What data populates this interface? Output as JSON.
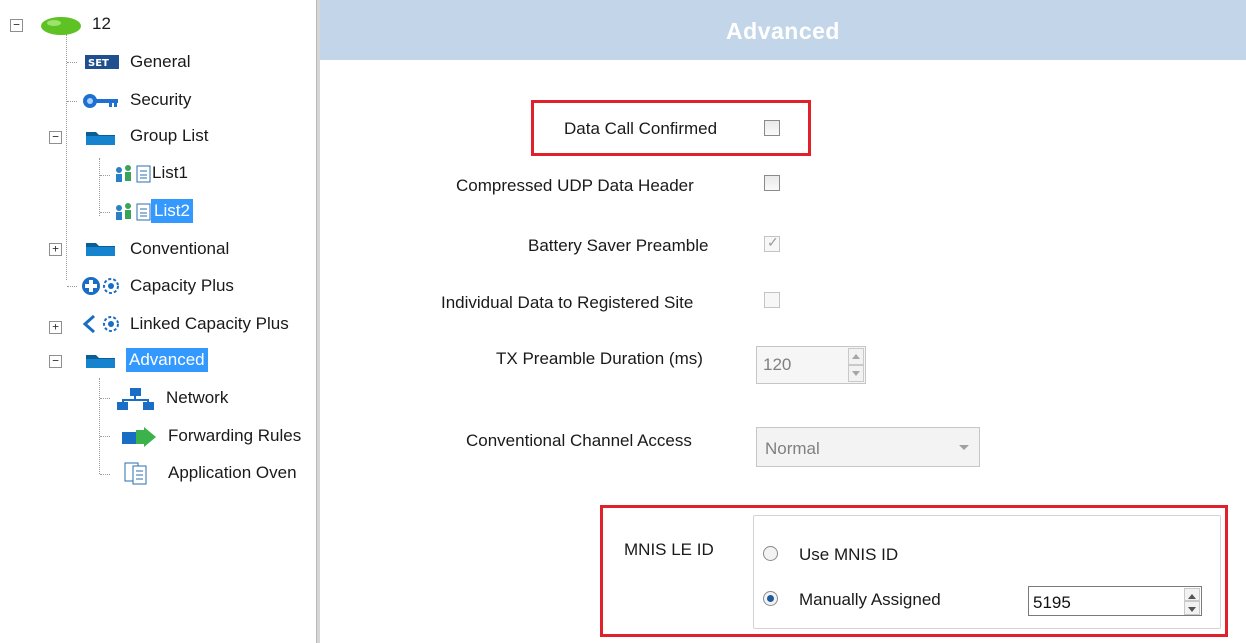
{
  "tree": {
    "root_label": "12",
    "items": {
      "general": "General",
      "security": "Security",
      "group_list": "Group List",
      "list1": "List1",
      "list2": "List2",
      "conventional": "Conventional",
      "capacity_plus": "Capacity Plus",
      "linked_capacity_plus": "Linked Capacity Plus",
      "advanced": "Advanced",
      "network": "Network",
      "forwarding_rules": "Forwarding Rules",
      "application_overview": "Application Oven"
    },
    "selected": [
      "List2",
      "Advanced"
    ],
    "expander_collapsed": "+",
    "expander_expanded": "−",
    "general_icon_text": "SET"
  },
  "header": {
    "title": "Advanced"
  },
  "form": {
    "data_call_confirmed": {
      "label": "Data Call Confirmed",
      "checked": false,
      "enabled": true
    },
    "compressed_udp": {
      "label": "Compressed UDP Data Header",
      "checked": false,
      "enabled": true
    },
    "battery_saver": {
      "label": "Battery Saver Preamble",
      "checked": true,
      "enabled": false,
      "mark": "✓"
    },
    "individual_data": {
      "label": "Individual Data to Registered Site",
      "checked": false,
      "enabled": false
    },
    "tx_preamble": {
      "label": "TX Preamble Duration (ms)",
      "value": "120",
      "enabled": false
    },
    "channel_access": {
      "label": "Conventional Channel Access",
      "value": "Normal",
      "enabled": false
    },
    "mnis": {
      "label": "MNIS LE ID",
      "option_use": "Use MNIS ID",
      "option_manual": "Manually Assigned",
      "selected": "Manually Assigned",
      "value": "5195"
    }
  },
  "colors": {
    "header_bg": "#c3d6e9",
    "highlight_red": "#e0202a",
    "selection_blue": "#3399ff"
  }
}
